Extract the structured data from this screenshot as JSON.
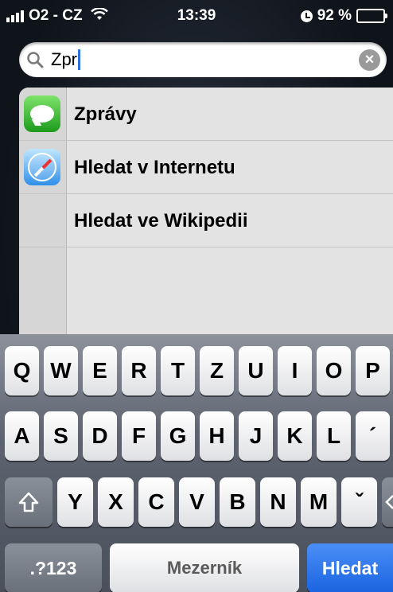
{
  "status_bar": {
    "carrier": "O2 - CZ",
    "time": "13:39",
    "battery_percent": "92 %",
    "battery_level": 0.92
  },
  "search": {
    "value": "Zpr"
  },
  "results": [
    {
      "label": "Zprávy",
      "icon": "messages-icon"
    },
    {
      "label": "Hledat v Internetu",
      "icon": "safari-icon"
    },
    {
      "label": "Hledat ve Wikipedii",
      "icon": ""
    }
  ],
  "keyboard": {
    "row1": [
      "Q",
      "W",
      "E",
      "R",
      "T",
      "Z",
      "U",
      "I",
      "O",
      "P"
    ],
    "row2": [
      "A",
      "S",
      "D",
      "F",
      "G",
      "H",
      "J",
      "K",
      "L",
      "´"
    ],
    "row3": [
      "Y",
      "X",
      "C",
      "V",
      "B",
      "N",
      "M",
      "ˇ"
    ],
    "numbers_label": ".?123",
    "space_label": "Mezerník",
    "search_label": "Hledat"
  }
}
